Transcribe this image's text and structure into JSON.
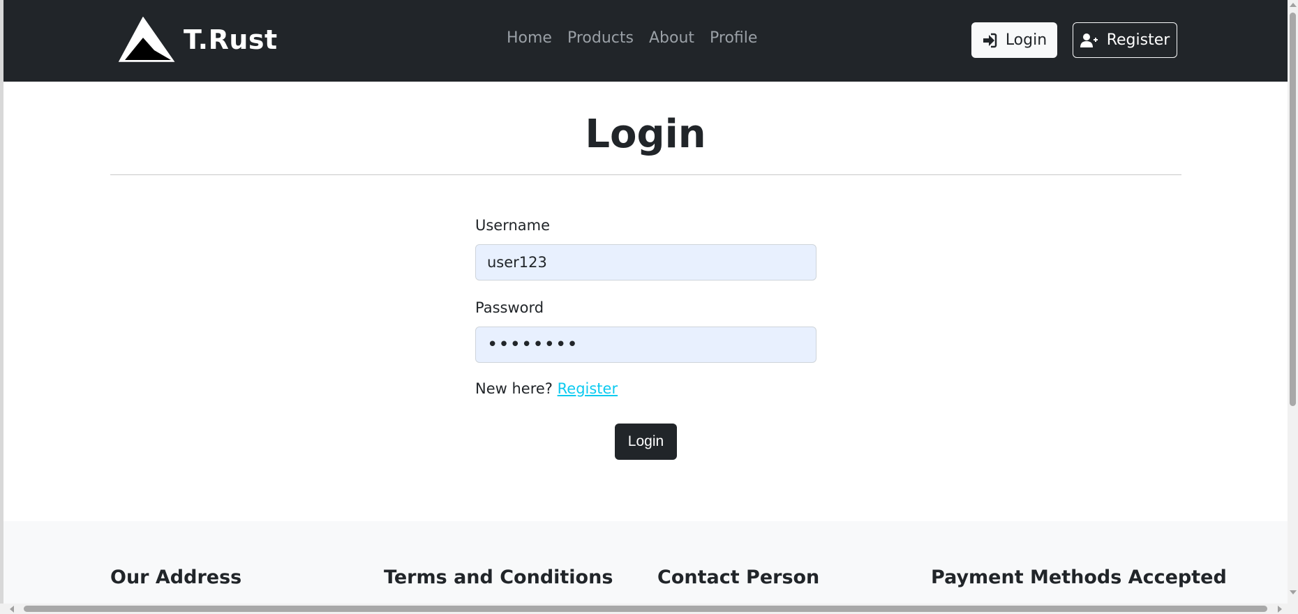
{
  "navbar": {
    "brand": "T.Rust",
    "links": [
      {
        "label": "Home"
      },
      {
        "label": "Products"
      },
      {
        "label": "About"
      },
      {
        "label": "Profile"
      }
    ],
    "login_label": "Login",
    "register_label": "Register",
    "login_icon": "sign-in-icon",
    "register_icon": "user-plus-icon"
  },
  "main": {
    "title": "Login",
    "username_label": "Username",
    "username_value": "user123",
    "password_label": "Password",
    "password_value": "••••••••",
    "new_here_text": "New here? ",
    "register_link": "Register",
    "submit_label": "Login"
  },
  "footer": {
    "headings": [
      "Our Address",
      "Terms and Conditions",
      "Contact Person",
      "Payment Methods Accepted"
    ]
  },
  "colors": {
    "navbar_bg": "#212529",
    "input_bg": "#e8f0fe",
    "link": "#0dcaf0",
    "footer_bg": "#f8f9fa"
  }
}
